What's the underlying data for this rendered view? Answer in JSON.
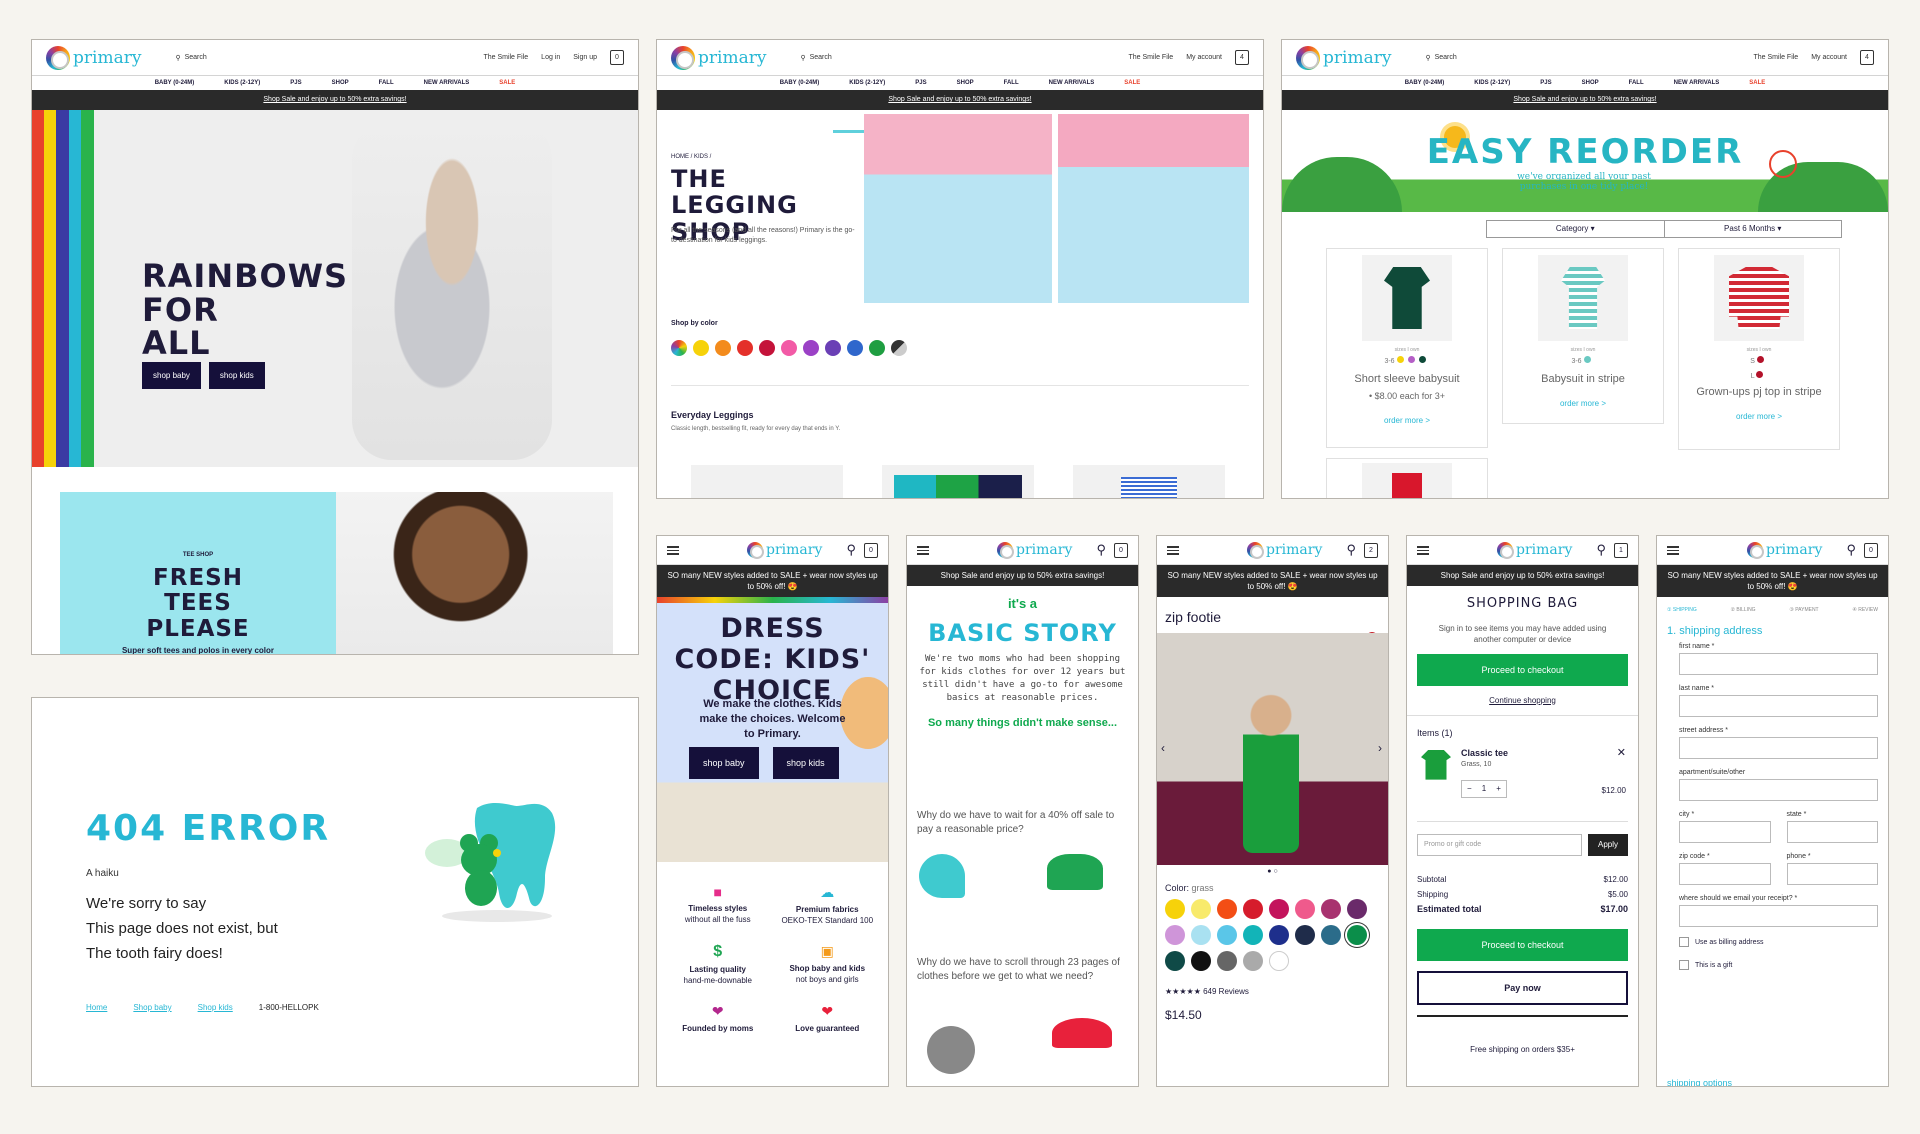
{
  "colors": {
    "teal": "#27b7d4",
    "navy": "#15103a",
    "green": "#0fa94e",
    "red": "#e8412c",
    "page_bg": "#f6f4ef"
  },
  "desktop_header": {
    "logo": "primary",
    "search": "Search",
    "smile_file": "The Smile File",
    "login": "Log in",
    "signup": "Sign up",
    "my_account": "My account",
    "bag_count_empty": "0",
    "bag_count_four": "4"
  },
  "nav": [
    "BABY (0-24M)",
    "KIDS (2-12Y)",
    "PJS",
    "SHOP",
    "FALL",
    "NEW ARRIVALS",
    "SALE"
  ],
  "promo": "Shop Sale and enjoy up to 50% extra savings!",
  "promo_sale": "SO many NEW styles added to SALE + wear now styles up to 50% off! 😍",
  "home": {
    "headline": "RAINBOWS FOR ALL",
    "btn_baby": "shop baby",
    "btn_kids": "shop kids",
    "tee_eyebrow": "TEE SHOP",
    "tee_title": "FRESH TEES PLEASE",
    "tee_sub": "Super soft tees and polos in every color of the rainbow"
  },
  "legging": {
    "crumb": "HOME  /  KIDS  /",
    "title": "THE LEGGING SHOP",
    "desc": "For all the seasons (and all the reasons!) Primary is the go-to destination for kids leggings.",
    "shop_color": "Shop by color",
    "everyday": "Everyday Leggings",
    "everyday_sub": "Classic length, bestselling fit, ready for every day that ends in Y."
  },
  "reorder": {
    "title": "EASY REORDER",
    "sub": "we've organized all your past purchases in one tidy place!",
    "filter_category": "Category",
    "filter_time": "Past 6 Months",
    "sizes_own": "sizes I own",
    "order_more": "order more >",
    "items": [
      {
        "name": "Short sleeve babysuit",
        "size": "3-6",
        "price": "• $8.00 each for 3+"
      },
      {
        "name": "Babysuit in stripe",
        "size": "3-6",
        "price": ""
      },
      {
        "name": "Grown-ups pj top in stripe",
        "size": "S",
        "size2": "L",
        "price": ""
      }
    ]
  },
  "error404": {
    "title": "404 ERROR",
    "haiku_label": "A haiku",
    "line1": "We're sorry to say",
    "line2": "This page does not exist, but",
    "line3": "The tooth fairy does!",
    "link_home": "Home",
    "link_baby": "Shop baby",
    "link_kids": "Shop kids",
    "phone": "1-800-HELLOPK"
  },
  "mobile_home": {
    "title": "DRESS CODE: KIDS' CHOICE",
    "sub": "We make the clothes. Kids make the choices. Welcome to Primary.",
    "btn_baby": "shop baby",
    "btn_kids": "shop kids",
    "features": [
      {
        "t": "Timeless styles",
        "s": "without all the fuss"
      },
      {
        "t": "Premium fabrics",
        "s": "OEKO-TEX Standard 100"
      },
      {
        "t": "Lasting quality",
        "s": "hand-me-downable"
      },
      {
        "t": "Shop baby and kids",
        "s": "not boys and girls"
      },
      {
        "t": "Founded by moms",
        "s": ""
      },
      {
        "t": "Love guaranteed",
        "s": ""
      }
    ]
  },
  "story": {
    "its_a": "it's a",
    "title": "BASIC STORY",
    "p1": "We're two moms who had been shopping for kids clothes for over 12 years but still didn't have a go-to for awesome basics at reasonable prices.",
    "p2": "So many things didn't make sense...",
    "q1": "Why do we have to wait for a 40% off sale to pay a reasonable price?",
    "q2": "Why do we have to scroll through 23 pages of clothes before we get to what we need?"
  },
  "product": {
    "name": "zip footie",
    "color_label": "Color:",
    "color_value": "grass",
    "reviews": "649 Reviews",
    "price": "$14.50",
    "bag_count": "2"
  },
  "bag": {
    "title": "SHOPPING BAG",
    "signin": "Sign in to see items you may have added using another computer or device",
    "checkout": "Proceed to checkout",
    "continue": "Continue shopping",
    "items_label": "Items (1)",
    "item_name": "Classic tee",
    "item_detail": "Grass, 10",
    "qty": "1",
    "item_price": "$12.00",
    "promo_ph": "Promo or gift code",
    "apply": "Apply",
    "subtotal_l": "Subtotal",
    "subtotal_v": "$12.00",
    "shipping_l": "Shipping",
    "shipping_v": "$5.00",
    "total_l": "Estimated total",
    "total_v": "$17.00",
    "paynow": "Pay now",
    "free_ship": "Free shipping on orders $35+",
    "bag_count": "1"
  },
  "checkout": {
    "steps": [
      "SHIPPING",
      "BILLING",
      "PAYMENT",
      "REVIEW"
    ],
    "heading": "1. shipping address",
    "fields": [
      "first name *",
      "last name *",
      "street address *",
      "apartment/suite/other"
    ],
    "city": "city *",
    "state": "state *",
    "zip": "zip code *",
    "phone": "phone *",
    "email": "where should we email your receipt? *",
    "cb1": "Use as billing address",
    "cb2": "This is a gift",
    "next": "shipping options",
    "bag_count": "0"
  }
}
